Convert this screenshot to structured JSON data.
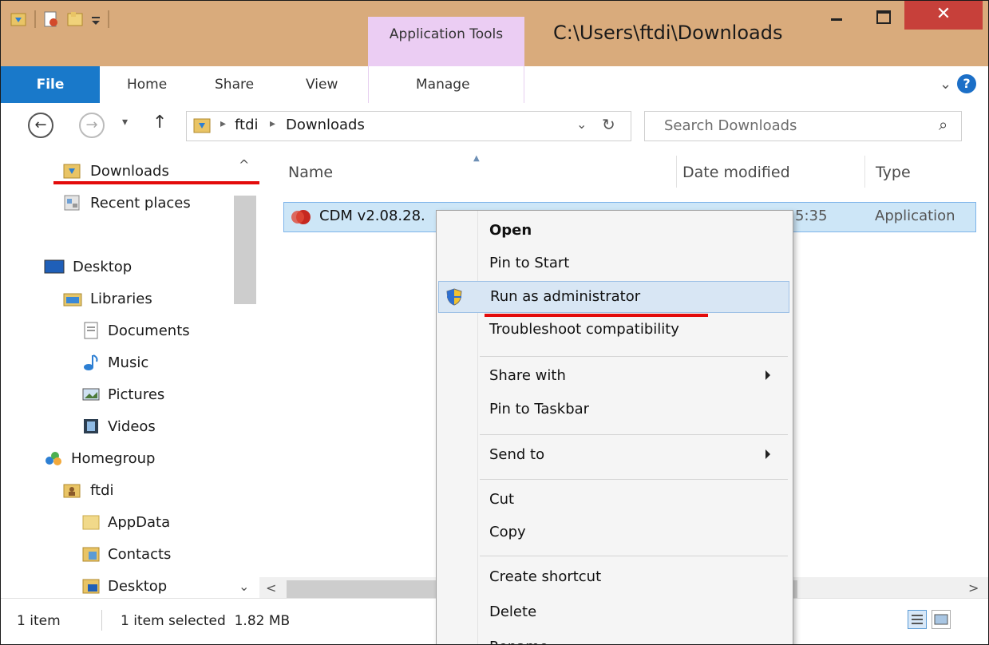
{
  "window": {
    "title": "C:\\Users\\ftdi\\Downloads",
    "contextual_tab": "Application Tools",
    "close_glyph": "✕"
  },
  "ribbon": {
    "tabs": [
      "File",
      "Home",
      "Share",
      "View",
      "Manage"
    ],
    "help_glyph": "?",
    "expand_glyph": "⌄"
  },
  "address": {
    "back_glyph": "←",
    "forward_glyph": "→",
    "history_glyph": "▾",
    "up_glyph": "↑",
    "sep_glyph": "▸",
    "crumbs": [
      "ftdi",
      "Downloads"
    ],
    "dropdown_glyph": "⌄",
    "refresh_glyph": "↻",
    "search_placeholder": "Search Downloads",
    "search_glyph": "⌕"
  },
  "nav": {
    "scroll_up_glyph": "^",
    "scroll_down_glyph": "⌄",
    "items": [
      {
        "label": "Downloads",
        "icon": "downloads-folder-icon"
      },
      {
        "label": "Recent places",
        "icon": "recent-places-icon"
      },
      {
        "label": "Desktop",
        "icon": "desktop-icon"
      },
      {
        "label": "Libraries",
        "icon": "libraries-icon"
      },
      {
        "label": "Documents",
        "icon": "documents-icon"
      },
      {
        "label": "Music",
        "icon": "music-icon"
      },
      {
        "label": "Pictures",
        "icon": "pictures-icon"
      },
      {
        "label": "Videos",
        "icon": "videos-icon"
      },
      {
        "label": "Homegroup",
        "icon": "homegroup-icon"
      },
      {
        "label": "ftdi",
        "icon": "user-folder-icon"
      },
      {
        "label": "AppData",
        "icon": "folder-icon"
      },
      {
        "label": "Contacts",
        "icon": "contacts-folder-icon"
      },
      {
        "label": "Desktop",
        "icon": "desktop-folder-icon"
      }
    ]
  },
  "columns": {
    "name": "Name",
    "date": "Date modified",
    "type": "Type",
    "sort_glyph": "▲"
  },
  "file": {
    "name": "CDM v2.08.28.",
    "date_fragment": "5:35",
    "type": "Application"
  },
  "hscroll": {
    "left_glyph": "<",
    "right_glyph": ">"
  },
  "status": {
    "items": "1 item",
    "selection": "1 item selected  1.82 MB"
  },
  "context_menu": {
    "items": [
      "Open",
      "Pin to Start",
      "Run as administrator",
      "Troubleshoot compatibility",
      "Share with",
      "Pin to Taskbar",
      "Send to",
      "Cut",
      "Copy",
      "Create shortcut",
      "Delete",
      "Rename"
    ]
  },
  "colors": {
    "titlebar": "#d9ab7c",
    "contextual_tab": "#ebcdf3",
    "file_tab": "#1979ca",
    "close_button": "#c7403a",
    "selection": "#cde6f7",
    "menu_highlight": "#d8e6f4",
    "annotation_underline": "#e30b0b"
  }
}
